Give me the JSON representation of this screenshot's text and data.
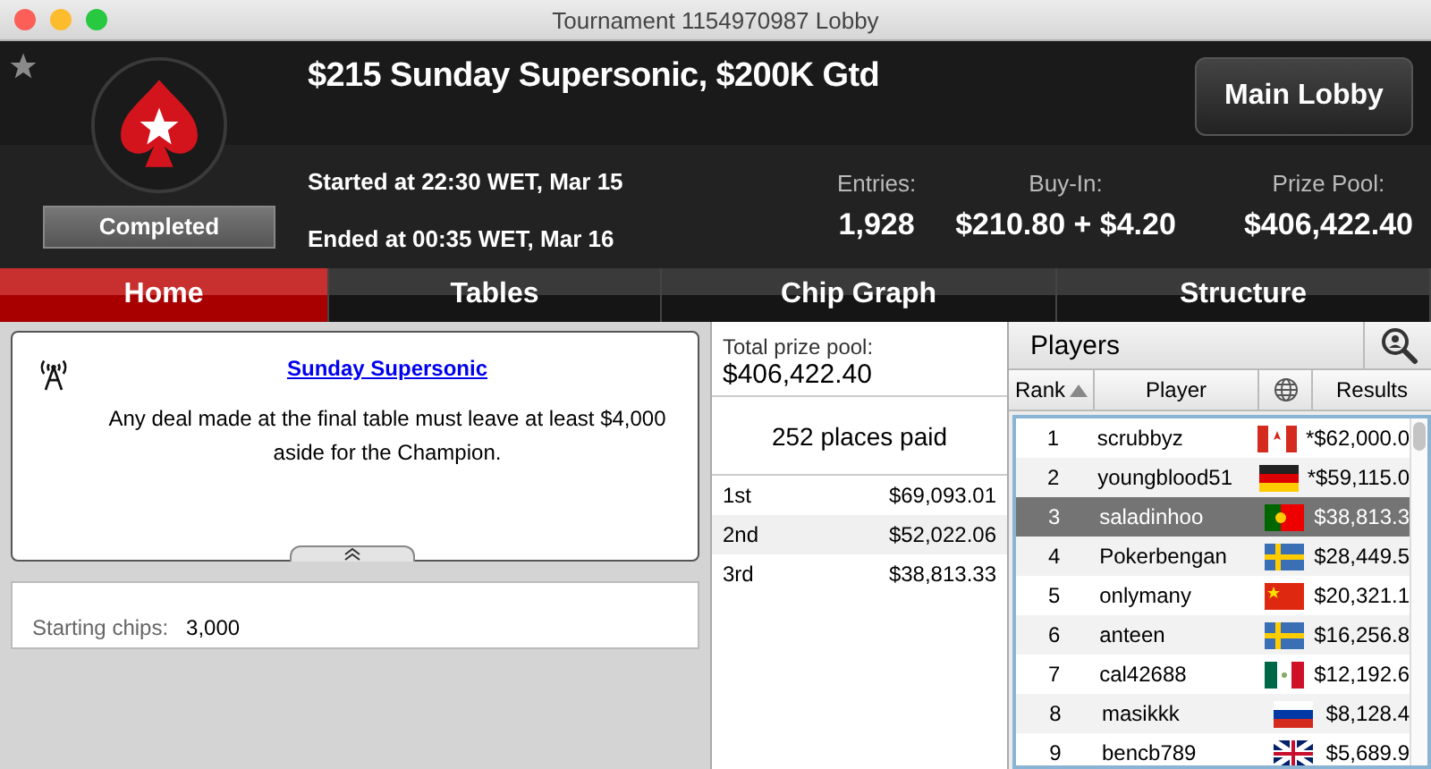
{
  "window": {
    "title": "Tournament 1154970987 Lobby"
  },
  "header": {
    "title": "$215 Sunday Supersonic, $200K Gtd",
    "status": "Completed",
    "started": "Started at 22:30 WET, Mar 15",
    "ended": "Ended at 00:35 WET, Mar 16",
    "main_lobby_button": "Main Lobby",
    "stats": [
      {
        "label": "Entries:",
        "value": "1,928"
      },
      {
        "label": "Buy-In:",
        "value": "$210.80 + $4.20"
      },
      {
        "label": "Prize Pool:",
        "value": "$406,422.40"
      }
    ]
  },
  "tabs": [
    {
      "label": "Home",
      "selected": true
    },
    {
      "label": "Tables",
      "selected": false
    },
    {
      "label": "Chip Graph",
      "selected": false
    },
    {
      "label": "Structure",
      "selected": false
    }
  ],
  "news": {
    "link": "Sunday Supersonic",
    "text": "Any deal made at the final table must leave at least $4,000 aside for the Champion."
  },
  "starting_chips": {
    "label": "Starting chips:",
    "value": "3,000"
  },
  "prizes": {
    "total_label": "Total prize pool:",
    "total": "$406,422.40",
    "places_paid": "252 places paid",
    "rows": [
      {
        "place": "1st",
        "amount": "$69,093.01"
      },
      {
        "place": "2nd",
        "amount": "$52,022.06"
      },
      {
        "place": "3rd",
        "amount": "$38,813.33"
      }
    ]
  },
  "players": {
    "title": "Players",
    "columns": [
      "Rank",
      "Player",
      "Results"
    ],
    "rows": [
      {
        "rank": "1",
        "player": "scrubbyz",
        "kind": "ca",
        "result": "*$62,000.0",
        "selected": false
      },
      {
        "rank": "2",
        "player": "youngblood51",
        "kind": "de",
        "result": "*$59,115.0",
        "selected": false
      },
      {
        "rank": "3",
        "player": "saladinhoo",
        "kind": "pt",
        "result": "$38,813.3",
        "selected": true
      },
      {
        "rank": "4",
        "player": "Pokerbengan",
        "kind": "se",
        "result": "$28,449.5",
        "selected": false
      },
      {
        "rank": "5",
        "player": "onlymany",
        "kind": "cn",
        "result": "$20,321.1",
        "selected": false
      },
      {
        "rank": "6",
        "player": "anteen",
        "kind": "se",
        "result": "$16,256.8",
        "selected": false
      },
      {
        "rank": "7",
        "player": "cal42688",
        "kind": "mx",
        "result": "$12,192.6",
        "selected": false
      },
      {
        "rank": "8",
        "player": "masikkk",
        "kind": "ru",
        "result": "$8,128.4",
        "selected": false
      },
      {
        "rank": "9",
        "player": "bencb789",
        "kind": "gb",
        "result": "$5,689.9",
        "selected": false
      }
    ]
  }
}
